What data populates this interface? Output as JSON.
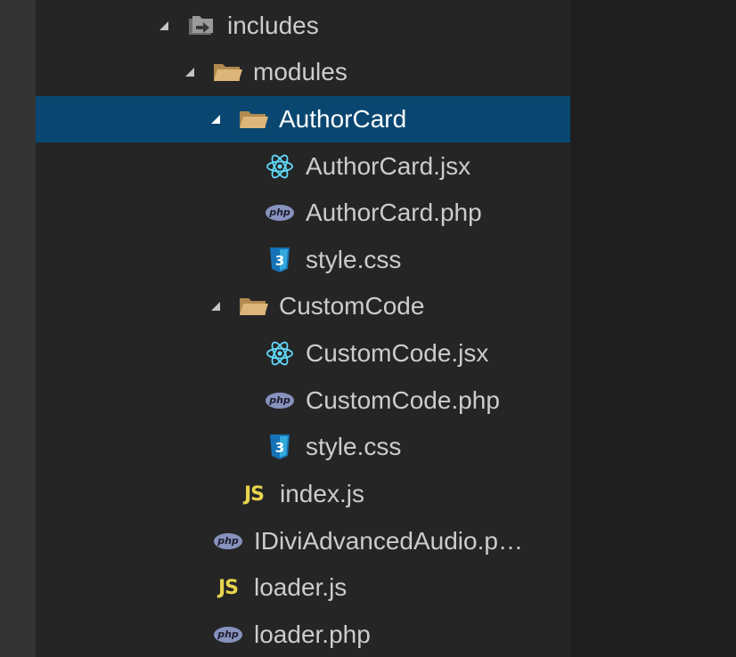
{
  "colors": {
    "selection": "#094771",
    "folder": "#dcb67a",
    "react": "#61dafb",
    "css": "#1572b6",
    "js": "#e8d44d",
    "php": "#8892bf"
  },
  "tree": [
    {
      "label": "includes",
      "kind": "folder-special",
      "icon": "folder-import-icon",
      "expanded": true
    },
    {
      "label": "modules",
      "kind": "folder",
      "icon": "folder-open-icon",
      "expanded": true
    },
    {
      "label": "AuthorCard",
      "kind": "folder",
      "icon": "folder-open-icon",
      "expanded": true,
      "selected": true
    },
    {
      "label": "AuthorCard.jsx",
      "kind": "file",
      "icon": "react-icon"
    },
    {
      "label": "AuthorCard.php",
      "kind": "file",
      "icon": "php-icon"
    },
    {
      "label": "style.css",
      "kind": "file",
      "icon": "css-icon"
    },
    {
      "label": "CustomCode",
      "kind": "folder",
      "icon": "folder-open-icon",
      "expanded": true
    },
    {
      "label": "CustomCode.jsx",
      "kind": "file",
      "icon": "react-icon"
    },
    {
      "label": "CustomCode.php",
      "kind": "file",
      "icon": "php-icon"
    },
    {
      "label": "style.css",
      "kind": "file",
      "icon": "css-icon"
    },
    {
      "label": "index.js",
      "kind": "file",
      "icon": "js-icon"
    },
    {
      "label": "IDiviAdvancedAudio.p…",
      "kind": "file",
      "icon": "php-icon"
    },
    {
      "label": "loader.js",
      "kind": "file",
      "icon": "js-icon"
    },
    {
      "label": "loader.php",
      "kind": "file",
      "icon": "php-icon"
    }
  ]
}
